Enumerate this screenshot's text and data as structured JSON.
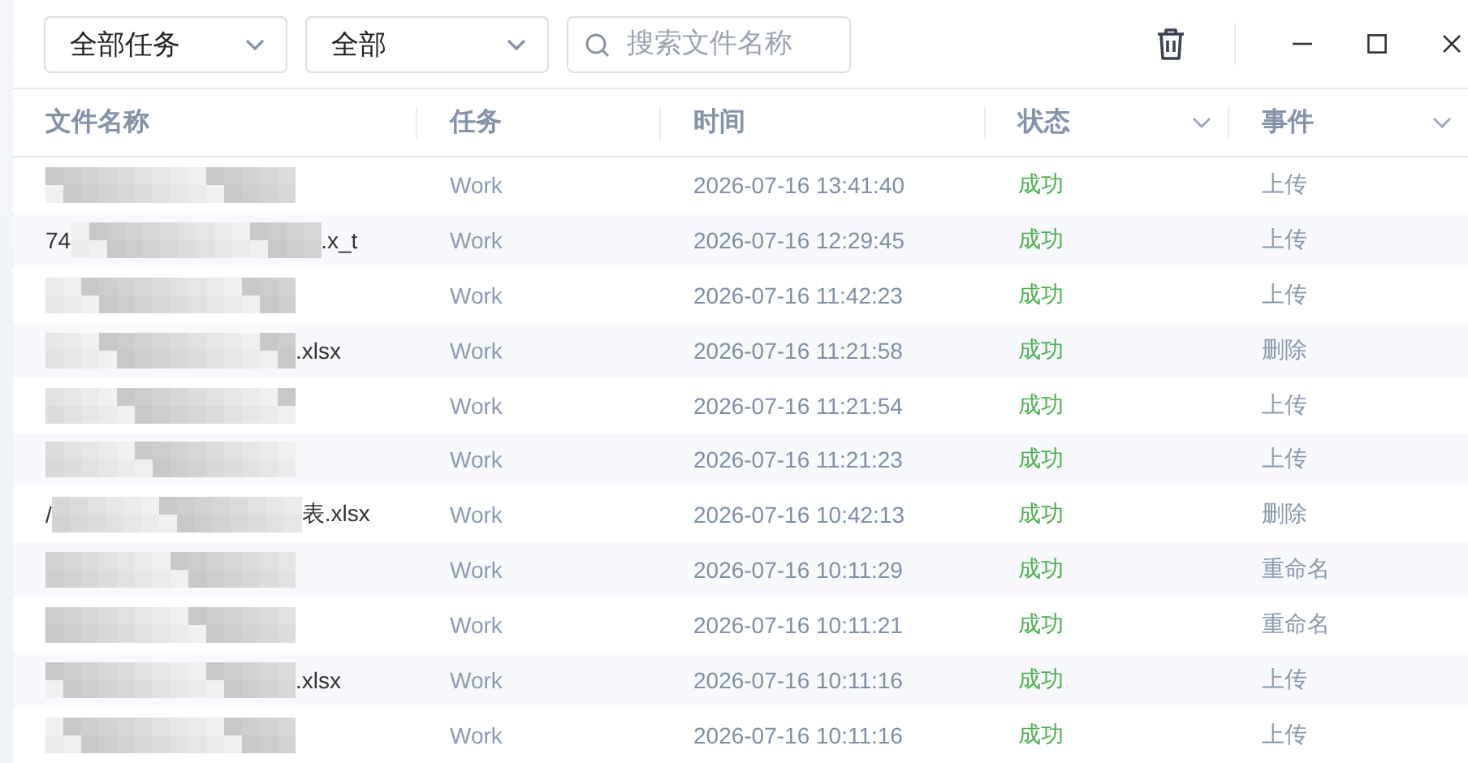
{
  "toolbar": {
    "task_filter": "全部任务",
    "status_filter": "全部",
    "search": {
      "placeholder": "搜索文件名称"
    }
  },
  "table": {
    "columns": [
      {
        "label": "文件名称",
        "sortable": false
      },
      {
        "label": "任务",
        "sortable": false
      },
      {
        "label": "时间",
        "sortable": false
      },
      {
        "label": "状态",
        "sortable": true
      },
      {
        "label": "事件",
        "sortable": true
      }
    ],
    "rows": [
      {
        "file_start": "",
        "file_end": "",
        "task": "Work",
        "time": "2026-07-16 13:41:40",
        "status": "成功",
        "event": "上传"
      },
      {
        "file_start": "74",
        "file_end": ".x_t",
        "task": "Work",
        "time": "2026-07-16 12:29:45",
        "status": "成功",
        "event": "上传"
      },
      {
        "file_start": "",
        "file_end": "",
        "task": "Work",
        "time": "2026-07-16 11:42:23",
        "status": "成功",
        "event": "上传"
      },
      {
        "file_start": "",
        "file_end": ".xlsx",
        "task": "Work",
        "time": "2026-07-16 11:21:58",
        "status": "成功",
        "event": "删除"
      },
      {
        "file_start": "",
        "file_end": "",
        "task": "Work",
        "time": "2026-07-16 11:21:54",
        "status": "成功",
        "event": "上传"
      },
      {
        "file_start": "",
        "file_end": "",
        "task": "Work",
        "time": "2026-07-16 11:21:23",
        "status": "成功",
        "event": "上传"
      },
      {
        "file_start": "/",
        "file_end": "表.xlsx",
        "task": "Work",
        "time": "2026-07-16 10:42:13",
        "status": "成功",
        "event": "删除"
      },
      {
        "file_start": "",
        "file_end": "",
        "task": "Work",
        "time": "2026-07-16 10:11:29",
        "status": "成功",
        "event": "重命名"
      },
      {
        "file_start": "",
        "file_end": "",
        "task": "Work",
        "time": "2026-07-16 10:11:21",
        "status": "成功",
        "event": "重命名"
      },
      {
        "file_start": "",
        "file_end": ".xlsx",
        "task": "Work",
        "time": "2026-07-16 10:11:16",
        "status": "成功",
        "event": "上传"
      },
      {
        "file_start": "",
        "file_end": "",
        "task": "Work",
        "time": "2026-07-16 10:11:16",
        "status": "成功",
        "event": "上传"
      }
    ]
  }
}
